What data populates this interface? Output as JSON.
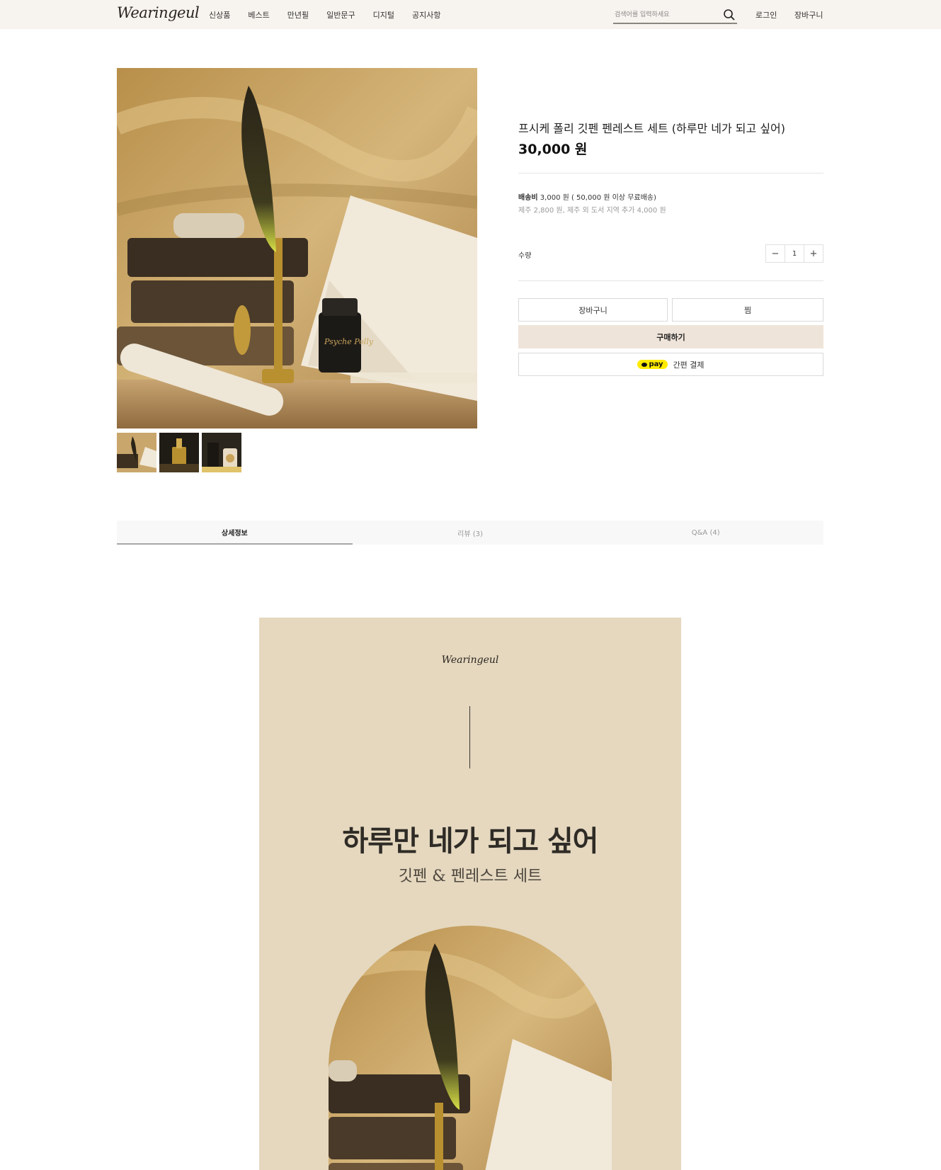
{
  "header": {
    "logo": "Wearingeul",
    "nav": [
      "신상품",
      "베스트",
      "만년필",
      "일반문구",
      "디지털",
      "공지사항"
    ],
    "search_placeholder": "검색어를 입력하세요",
    "login": "로그인",
    "cart": "장바구니"
  },
  "product": {
    "title": "프시케 폴리 깃펜 펜레스트 세트 (하루만 네가 되고 싶어)",
    "price": "30,000 원",
    "shipping_label": "배송비",
    "shipping_value": "3,000 원 ( 50,000 원 이상 무료배송)",
    "shipping_sub": "제주 2,800 원, 제주 외 도서 지역 추가 4,000 원",
    "quantity_label": "수량",
    "quantity": "1",
    "minus": "−",
    "plus": "+",
    "buttons": {
      "cart": "장바구니",
      "wish": "찜",
      "buy": "구매하기",
      "pay_badge": "pay",
      "pay": "간편 결제"
    },
    "ink_label": "Psyche Polly"
  },
  "tabs": [
    "상세정보",
    "리뷰 (3)",
    "Q&A (4)"
  ],
  "detail": {
    "logo": "Wearingeul",
    "headline": "하루만 네가 되고 싶어",
    "subtitle": "깃펜 & 펜레스트 세트"
  },
  "colors": {
    "header_bg": "#f7f3ee",
    "buy_bg": "#efe4d9",
    "detail_bg": "#e5d8bf",
    "pay_yellow": "#ffeb00"
  }
}
